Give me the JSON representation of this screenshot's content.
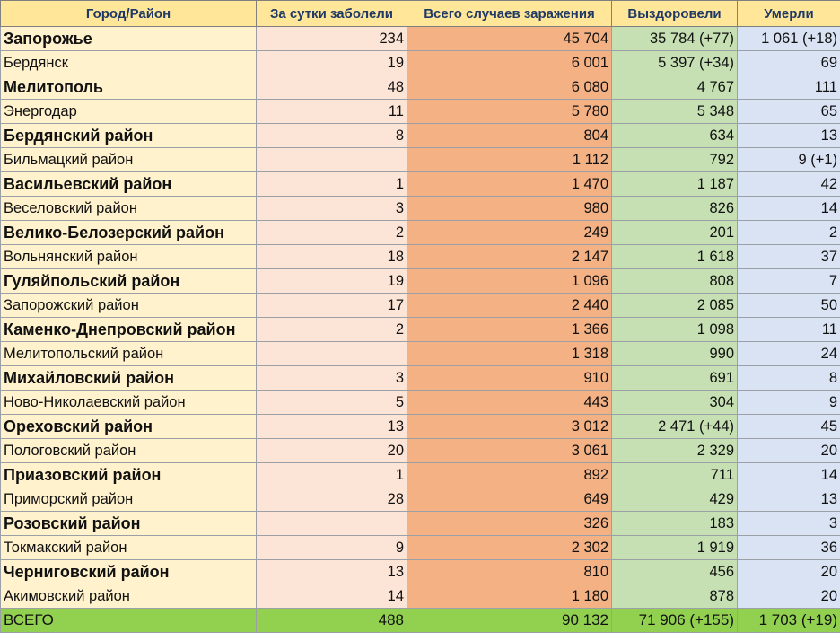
{
  "header": {
    "city": "Город/Район",
    "daily": "За сутки заболели",
    "total": "Всего случаев заражения",
    "recovered": "Выздоровели",
    "died": "Умерли"
  },
  "rows": [
    {
      "name": "Запорожье",
      "daily": "234",
      "total": "45 704",
      "recovered": "35 784 (+77)",
      "died": "1 061 (+18)",
      "bold": true
    },
    {
      "name": "Бердянск",
      "daily": "19",
      "total": "6 001",
      "recovered": "5 397 (+34)",
      "died": "69",
      "bold": false
    },
    {
      "name": "Мелитополь",
      "daily": "48",
      "total": "6 080",
      "recovered": "4 767",
      "died": "111",
      "bold": true
    },
    {
      "name": "Энергодар",
      "daily": "11",
      "total": "5 780",
      "recovered": "5 348",
      "died": "65",
      "bold": false
    },
    {
      "name": "Бердянский район",
      "daily": "8",
      "total": "804",
      "recovered": "634",
      "died": "13",
      "bold": true
    },
    {
      "name": "Бильмацкий район",
      "daily": "",
      "total": "1 112",
      "recovered": "792",
      "died": "9  (+1)",
      "bold": false
    },
    {
      "name": "Васильевский район",
      "daily": "1",
      "total": "1 470",
      "recovered": "1 187",
      "died": "42",
      "bold": true
    },
    {
      "name": "Веселовский район",
      "daily": "3",
      "total": "980",
      "recovered": "826",
      "died": "14",
      "bold": false
    },
    {
      "name": "Велико-Белозерский район",
      "daily": "2",
      "total": "249",
      "recovered": "201",
      "died": "2",
      "bold": true
    },
    {
      "name": "Вольнянский район",
      "daily": "18",
      "total": "2 147",
      "recovered": "1 618",
      "died": "37",
      "bold": false
    },
    {
      "name": "Гуляйпольский район",
      "daily": "19",
      "total": "1 096",
      "recovered": "808",
      "died": "7",
      "bold": true
    },
    {
      "name": "Запорожский район",
      "daily": "17",
      "total": "2 440",
      "recovered": "2 085",
      "died": "50",
      "bold": false
    },
    {
      "name": "Каменко-Днепровский район",
      "daily": "2",
      "total": "1 366",
      "recovered": "1 098",
      "died": "11",
      "bold": true
    },
    {
      "name": "Мелитопольский район",
      "daily": "",
      "total": "1 318",
      "recovered": "990",
      "died": "24",
      "bold": false
    },
    {
      "name": "Михайловский район",
      "daily": "3",
      "total": "910",
      "recovered": "691",
      "died": "8",
      "bold": true
    },
    {
      "name": "Ново-Николаевский район",
      "daily": "5",
      "total": "443",
      "recovered": "304",
      "died": "9",
      "bold": false
    },
    {
      "name": "Ореховский район",
      "daily": "13",
      "total": "3 012",
      "recovered": "2 471 (+44)",
      "died": "45",
      "bold": true
    },
    {
      "name": "Пологовский район",
      "daily": "20",
      "total": "3 061",
      "recovered": "2 329",
      "died": "20",
      "bold": false
    },
    {
      "name": "Приазовский район",
      "daily": "1",
      "total": "892",
      "recovered": "711",
      "died": "14",
      "bold": true
    },
    {
      "name": "Приморский район",
      "daily": "28",
      "total": "649",
      "recovered": "429",
      "died": "13",
      "bold": false
    },
    {
      "name": "Розовский район",
      "daily": "",
      "total": "326",
      "recovered": "183",
      "died": "3",
      "bold": true
    },
    {
      "name": "Токмакский район",
      "daily": "9",
      "total": "2 302",
      "recovered": "1 919",
      "died": "36",
      "bold": false
    },
    {
      "name": "Черниговский район",
      "daily": "13",
      "total": "810",
      "recovered": "456",
      "died": "20",
      "bold": true
    },
    {
      "name": "Акимовский район",
      "daily": "14",
      "total": "1 180",
      "recovered": "878",
      "died": "20",
      "bold": false
    }
  ],
  "summary": {
    "name": "ВСЕГО",
    "daily": "488",
    "total": "90 132",
    "recovered": "71 906 (+155)",
    "died": "1 703 (+19)"
  },
  "colors": {
    "header": "#ffe699",
    "name_column": "#fff2cc",
    "daily_column": "#fce4d6",
    "total_column": "#f4b183",
    "recovered_column": "#c6e0b4",
    "died_column": "#dae3f3",
    "summary_row": "#92d050",
    "header_text": "#1f3864"
  }
}
